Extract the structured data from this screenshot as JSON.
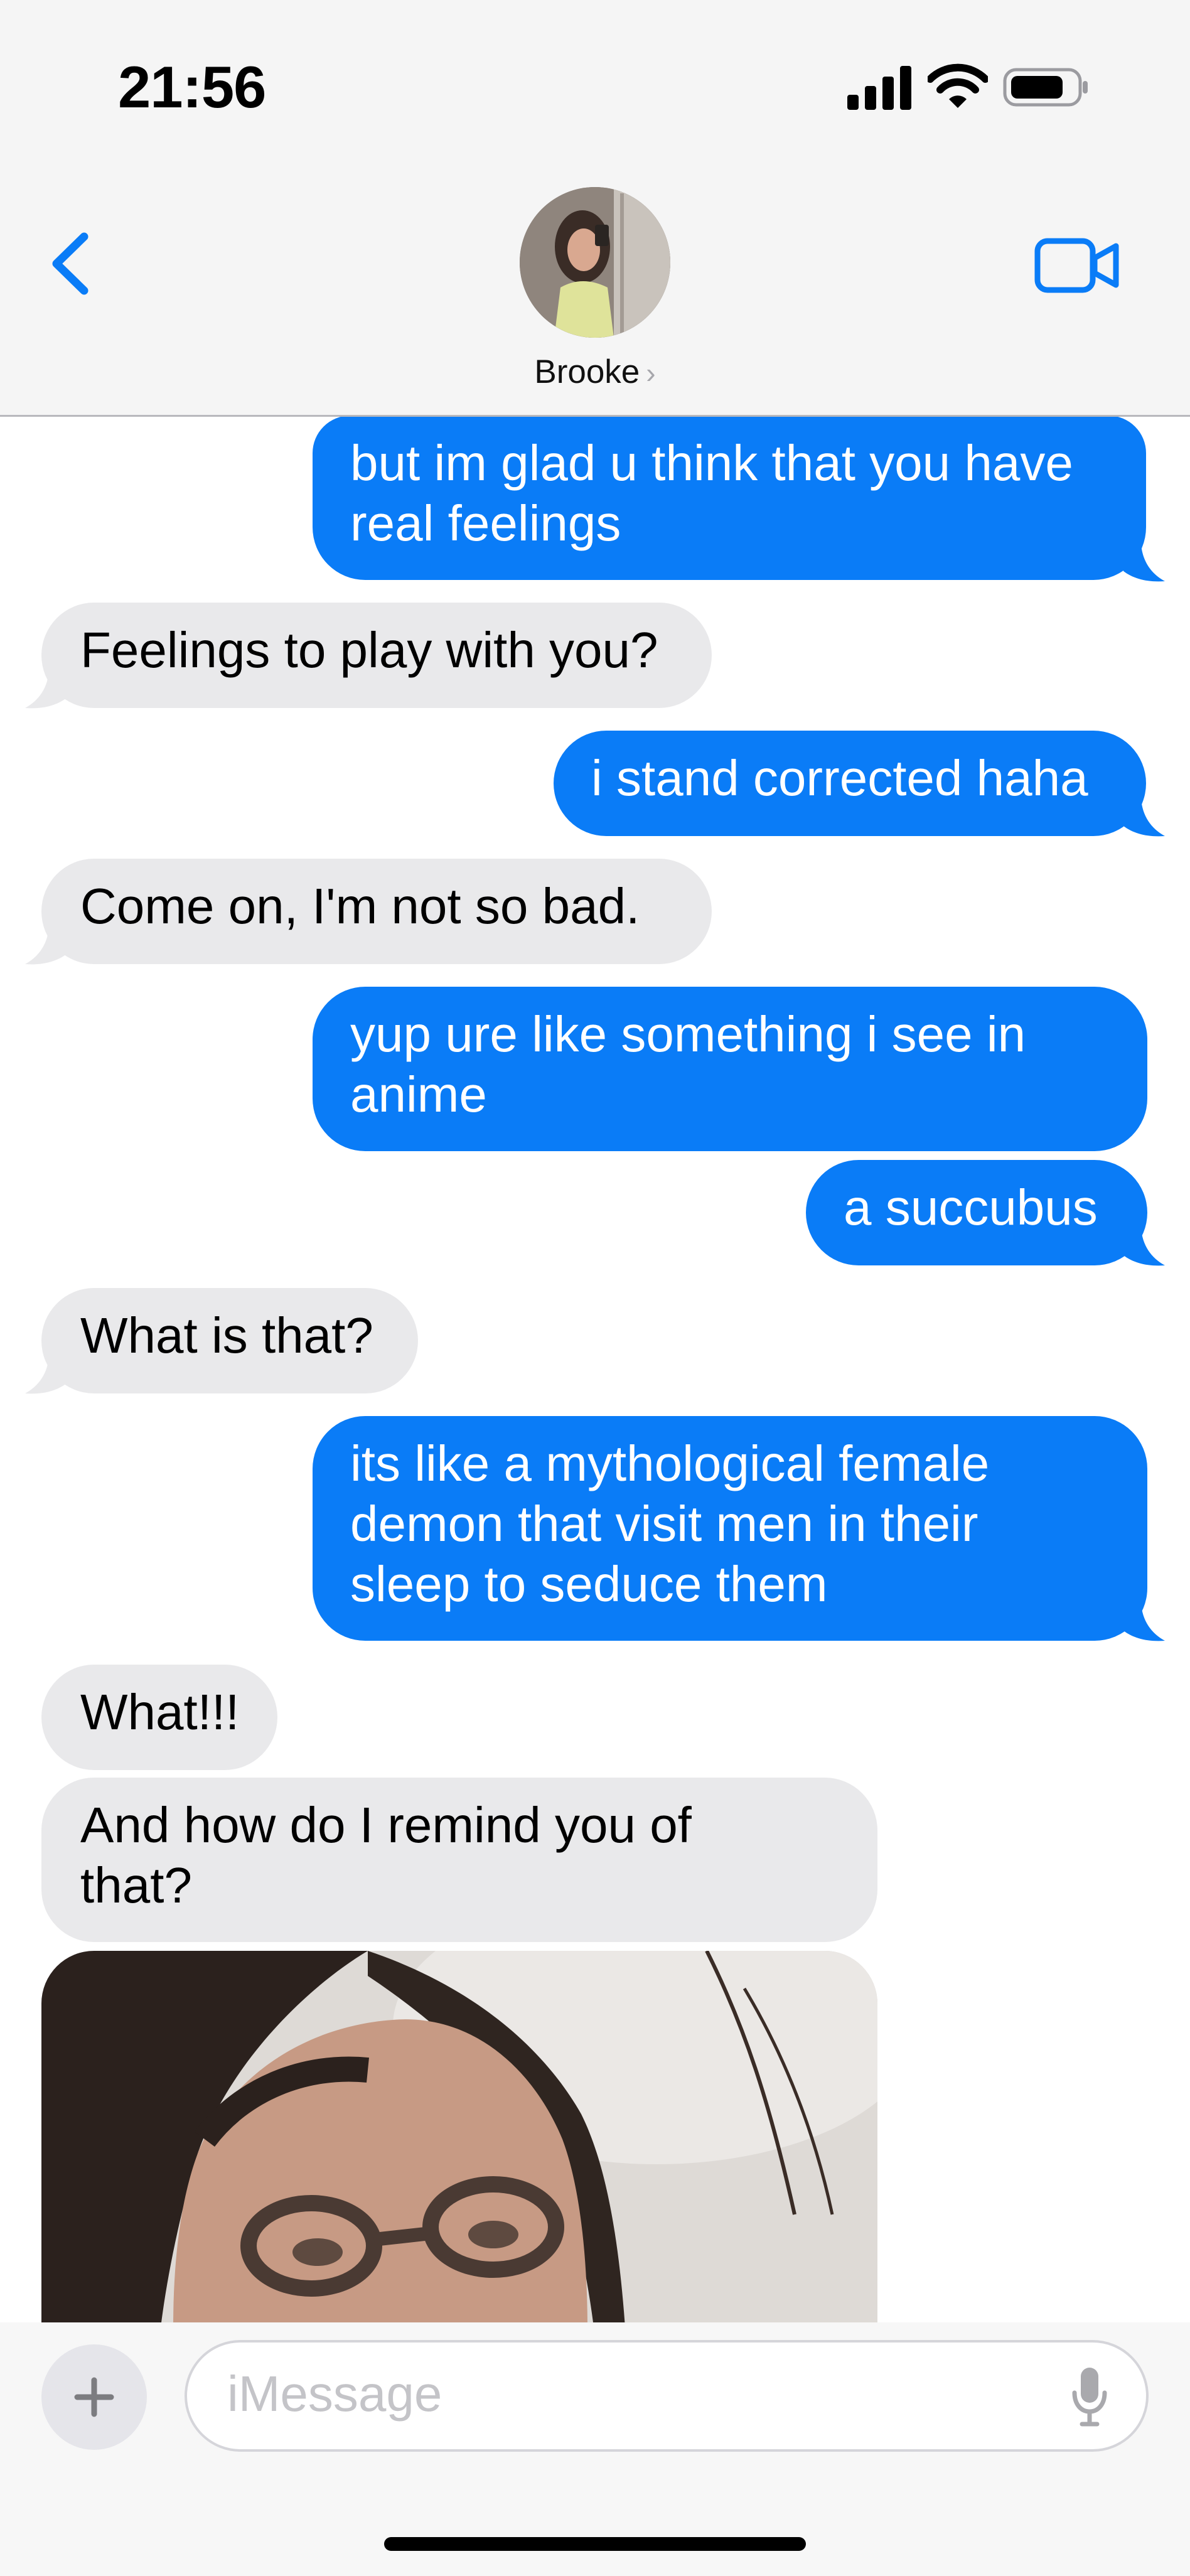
{
  "status_bar": {
    "time": "21:56"
  },
  "header": {
    "contact_name": "Brooke",
    "chevron": "›",
    "back_icon": "chevron-left-icon",
    "video_icon": "video-camera-icon"
  },
  "colors": {
    "outgoing": "#0a7cf7",
    "incoming": "#e9e9eb",
    "accent": "#0a7cf7"
  },
  "messages": [
    {
      "direction": "outgoing",
      "lines": [
        "but im glad u think that you have",
        "real feelings"
      ]
    },
    {
      "direction": "incoming",
      "lines": [
        "Feelings to play with you?"
      ]
    },
    {
      "direction": "outgoing",
      "lines": [
        "i stand corrected haha"
      ]
    },
    {
      "direction": "incoming",
      "lines": [
        "Come on, I'm not so bad."
      ]
    },
    {
      "direction": "outgoing",
      "lines": [
        "yup ure like something i see in",
        "anime"
      ]
    },
    {
      "direction": "outgoing",
      "lines": [
        "a succubus"
      ]
    },
    {
      "direction": "incoming",
      "lines": [
        "What is that?"
      ]
    },
    {
      "direction": "outgoing",
      "lines": [
        "its like a mythological female",
        "demon that visit men in their",
        "sleep to seduce them"
      ]
    },
    {
      "direction": "incoming",
      "lines": [
        "What!!!"
      ]
    },
    {
      "direction": "incoming",
      "lines": [
        "And how do I remind you of",
        "that?"
      ]
    }
  ],
  "attachment": {
    "type": "photo"
  },
  "composer": {
    "placeholder": "iMessage",
    "plus_icon": "plus-icon",
    "mic_icon": "microphone-icon"
  }
}
